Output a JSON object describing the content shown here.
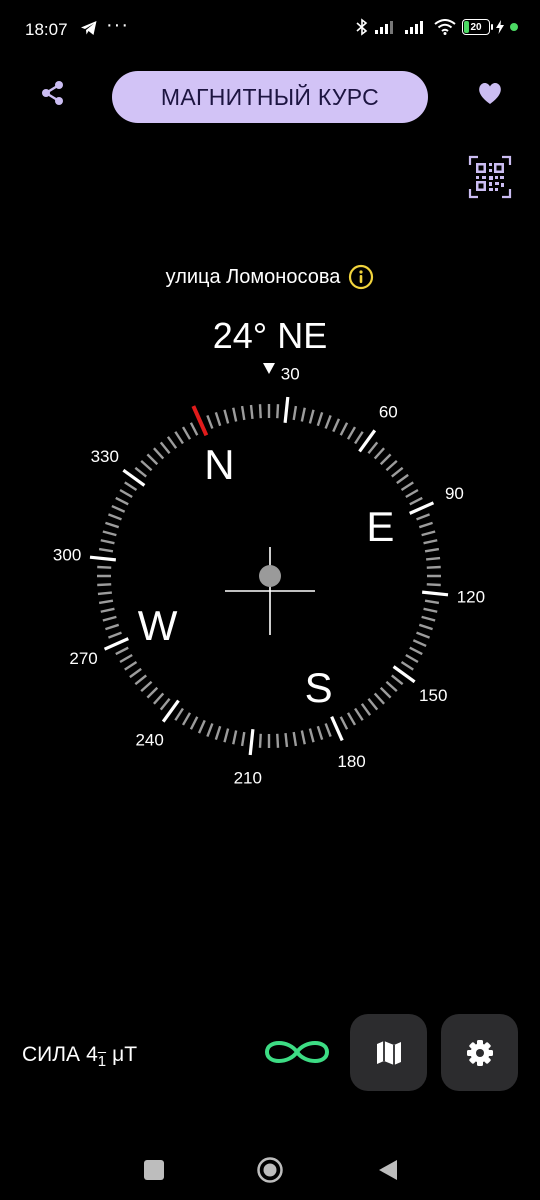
{
  "status_bar": {
    "time": "18:07",
    "telegram_icon": "telegram-icon",
    "more": "···",
    "battery_level": "20"
  },
  "header": {
    "title": "МАГНИТНЫЙ КУРС",
    "accent_color": "#d2c3f6"
  },
  "location": {
    "street": "улица Ломоносова"
  },
  "heading": {
    "text": "24° NE"
  },
  "compass": {
    "rotation_deg": -24,
    "degree_labels": [
      "30",
      "60",
      "90",
      "120",
      "150",
      "180",
      "210",
      "240",
      "270",
      "300",
      "330"
    ],
    "cardinals": [
      "N",
      "E",
      "S",
      "W"
    ],
    "needle_color": "#e01b1b"
  },
  "bottom": {
    "strength_label": "СИЛА",
    "strength_value": "4",
    "strength_sub": "1",
    "strength_unit": "μT",
    "infinity_color": "#3ddc84"
  }
}
